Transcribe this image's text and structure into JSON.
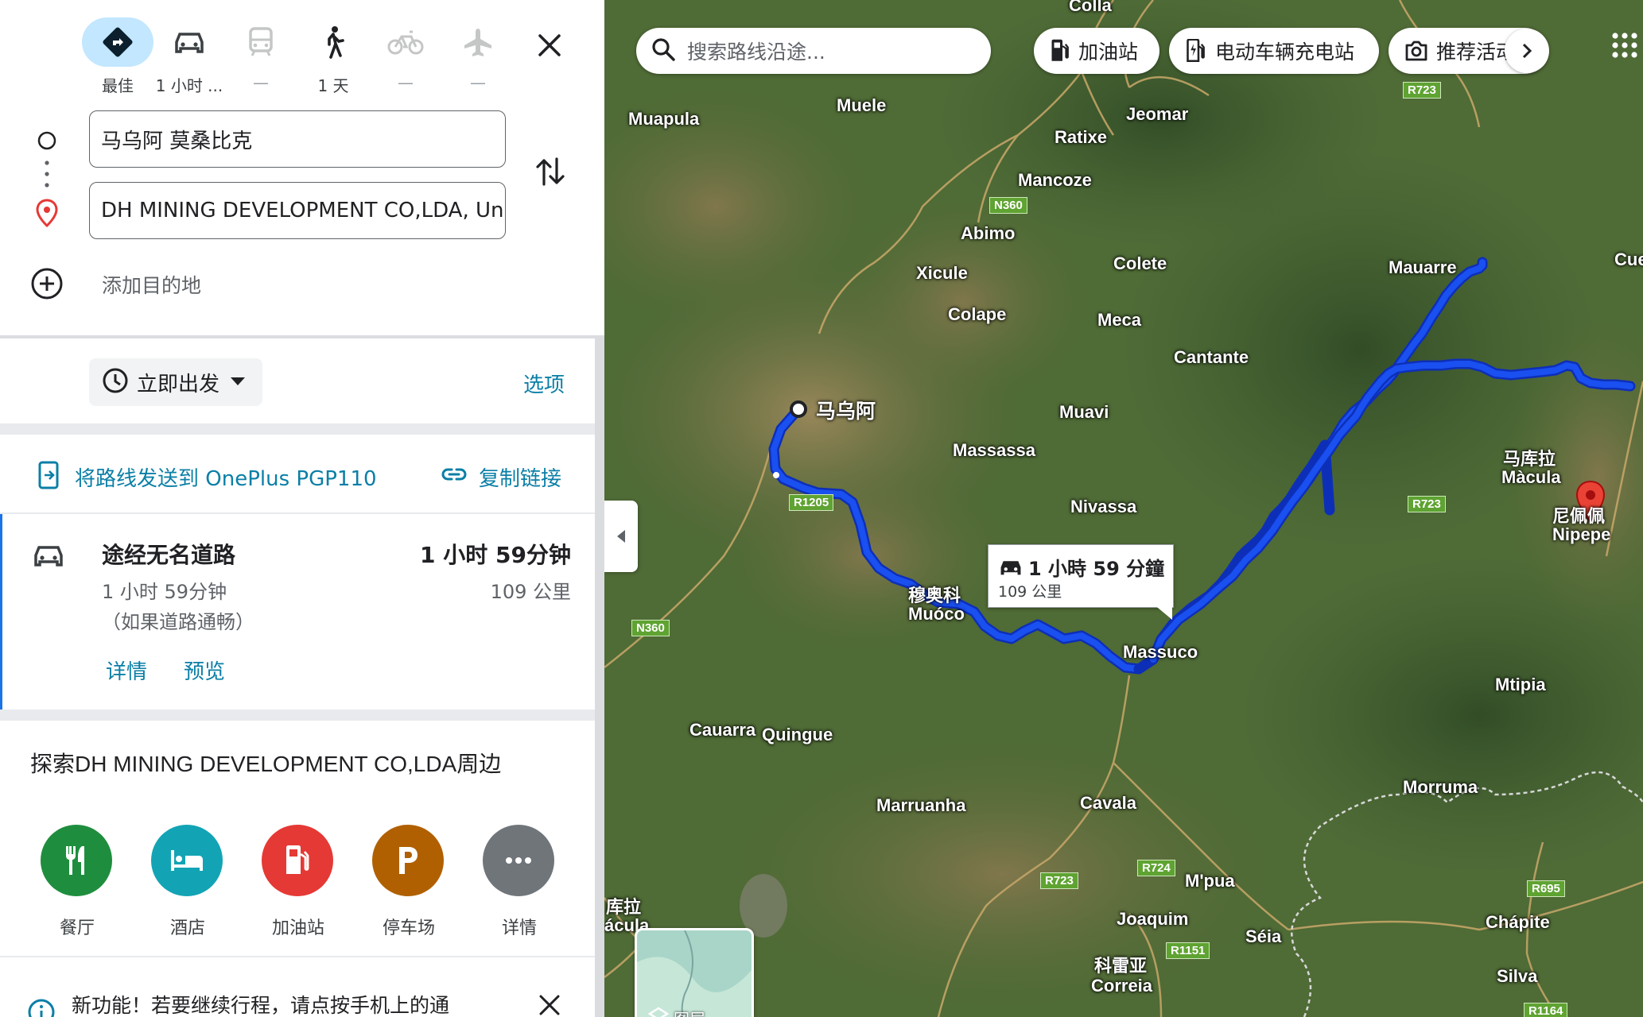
{
  "modes": [
    {
      "label": "最佳",
      "icon": "directions-icon",
      "selected": true
    },
    {
      "label": "1 小时 ...",
      "icon": "car-icon",
      "selected": false
    },
    {
      "label": "—",
      "icon": "transit-icon",
      "selected": false,
      "disabled": true
    },
    {
      "label": "1 天",
      "icon": "walk-icon",
      "selected": false
    },
    {
      "label": "—",
      "icon": "bike-icon",
      "selected": false,
      "disabled": true
    },
    {
      "label": "—",
      "icon": "flight-icon",
      "selected": false,
      "disabled": true
    }
  ],
  "origin": {
    "value": "马乌阿 莫桑比克"
  },
  "destination": {
    "value": "DH MINING DEVELOPMENT CO,LDA, Unnamed"
  },
  "add_destination": "添加目的地",
  "depart": {
    "label": "立即出发",
    "options": "选项"
  },
  "send": {
    "label": "将路线发送到 OnePlus PGP110",
    "copy": "复制链接"
  },
  "route": {
    "title": "途经无名道路",
    "duration": "1 小时 59分钟",
    "sub_duration": "1 小时 59分钟",
    "traffic_note": "（如果道路通畅）",
    "distance": "109 公里",
    "details": "详情",
    "preview": "预览"
  },
  "explore": {
    "title": "探索DH MINING DEVELOPMENT CO,LDA周边",
    "items": [
      {
        "label": "餐厅",
        "icon": "restaurant-icon",
        "color": "#1e8e3e"
      },
      {
        "label": "酒店",
        "icon": "hotel-icon",
        "color": "#12a4b5"
      },
      {
        "label": "加油站",
        "icon": "gas-station-icon",
        "color": "#e53935"
      },
      {
        "label": "停车场",
        "icon": "parking-icon",
        "color": "#b06000"
      },
      {
        "label": "详情",
        "icon": "more-icon",
        "color": "#70757a"
      }
    ]
  },
  "notice": {
    "text": "新功能！若要继续行程，请点按手机上的通"
  },
  "map": {
    "search_placeholder": "搜索路线沿途...",
    "chips": [
      "加油站",
      "电动车辆充电站",
      "推荐活动"
    ],
    "route_box": {
      "duration": "1 小時 59 分鐘",
      "distance": "109 公里"
    },
    "origin_label": "马乌阿",
    "dest_label_cn": "尼佩佩",
    "dest_label": "Nipepe",
    "thumbnail_label": "图层",
    "places": [
      "Colla",
      "Muapula",
      "Muele",
      "Jeomar",
      "Ratixe",
      "Mancoze",
      "Abimo",
      "Xicule",
      "Colete",
      "Mauarre",
      "Cue",
      "Colape",
      "Meca",
      "Cantante",
      "Muavi",
      "Massassa",
      "马库拉",
      "Màcula",
      "Nivassa",
      "穆奥科",
      "Muóco",
      "Massuco",
      "Mtipia",
      "Cauarra",
      "Quingue",
      "Morruma",
      "Marruanha",
      "Cavala",
      "M'pua",
      "库拉",
      "ácula",
      "Joaquim",
      "Séia",
      "Chápite",
      "科雷亚",
      "Correia",
      "Silva"
    ],
    "shields": [
      "N360",
      "R1205",
      "N360",
      "R723",
      "R723",
      "R723",
      "R724",
      "R1151",
      "R695",
      "R1164"
    ],
    "accent_route": "#1a4ff0"
  }
}
